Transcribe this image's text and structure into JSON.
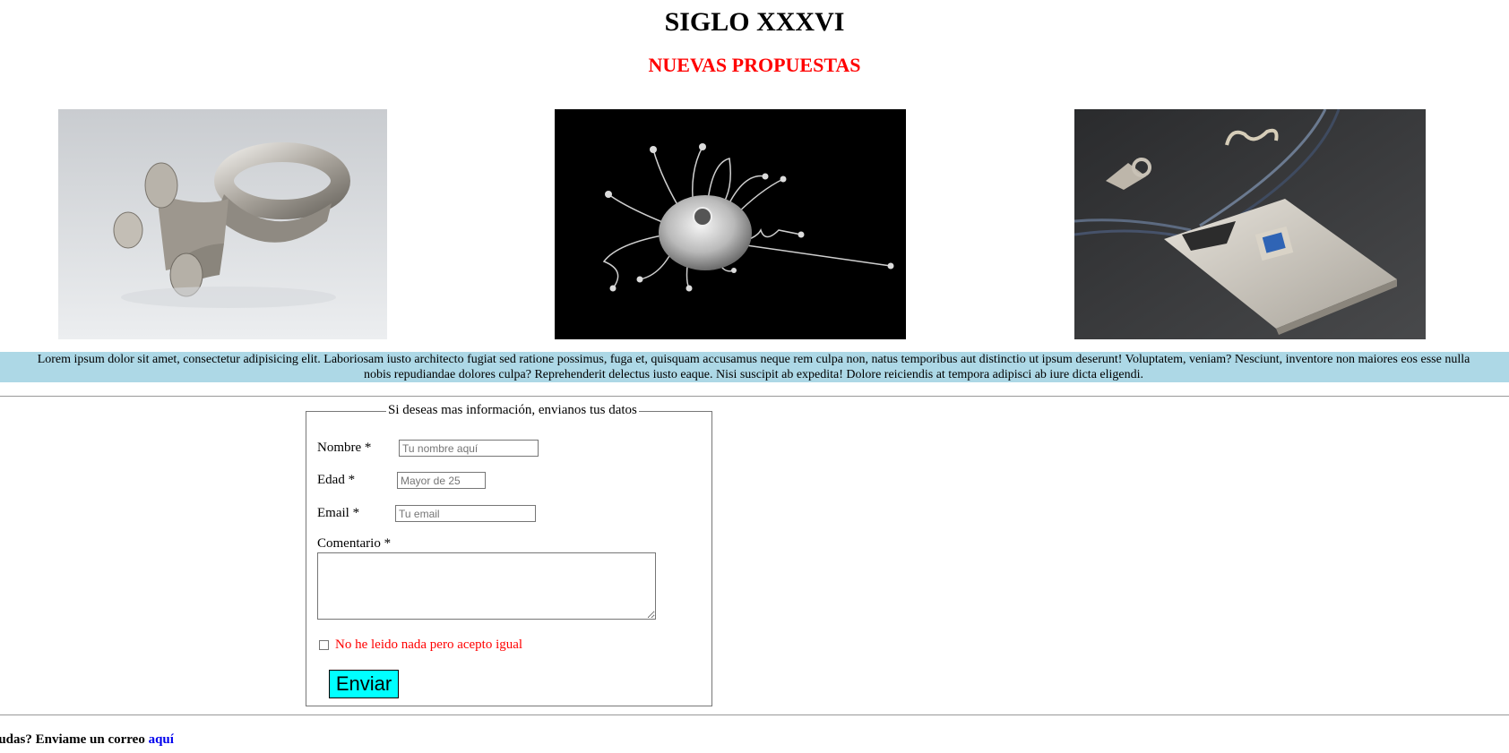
{
  "header": {
    "title": "SIGLO XXXVI",
    "subtitle": "NUEVAS PROPUESTAS"
  },
  "gallery": [
    {
      "icon": "silver-ring-photo"
    },
    {
      "icon": "silver-brooch-photo"
    },
    {
      "icon": "silver-pendant-photo"
    }
  ],
  "colors": {
    "subtitle": "#ff0000",
    "lorem_background": "#add8e6",
    "submit_background": "#00ffff",
    "checkbox_label": "#ff0000",
    "link": "#0000ee"
  },
  "intro_text": "Lorem ipsum dolor sit amet, consectetur adipisicing elit. Laboriosam iusto architecto fugiat sed ratione possimus, fuga et, quisquam accusamus neque rem culpa non, natus temporibus aut distinctio ut ipsum deserunt! Voluptatem, veniam? Nesciunt, inventore non maiores eos esse nulla\nnobis repudiandae dolores culpa? Reprehenderit delectus iusto eaque. Nisi suscipit ab expedita! Dolore reiciendis at tempora adipisci ab iure dicta eligendi.",
  "form": {
    "legend": "Si deseas mas información, envianos tus datos",
    "nombre_label": "Nombre *",
    "nombre_placeholder": "Tu nombre aquí",
    "edad_label": "Edad *",
    "edad_placeholder": "Mayor de 25",
    "email_label": "Email *",
    "email_placeholder": "Tu email",
    "comentario_label": "Comentario *",
    "checkbox_label": "No he leido nada pero acepto igual",
    "submit_label": "Enviar"
  },
  "footer": {
    "text": "¿Dudas? Enviame un correo ",
    "link_text": "aquí"
  }
}
